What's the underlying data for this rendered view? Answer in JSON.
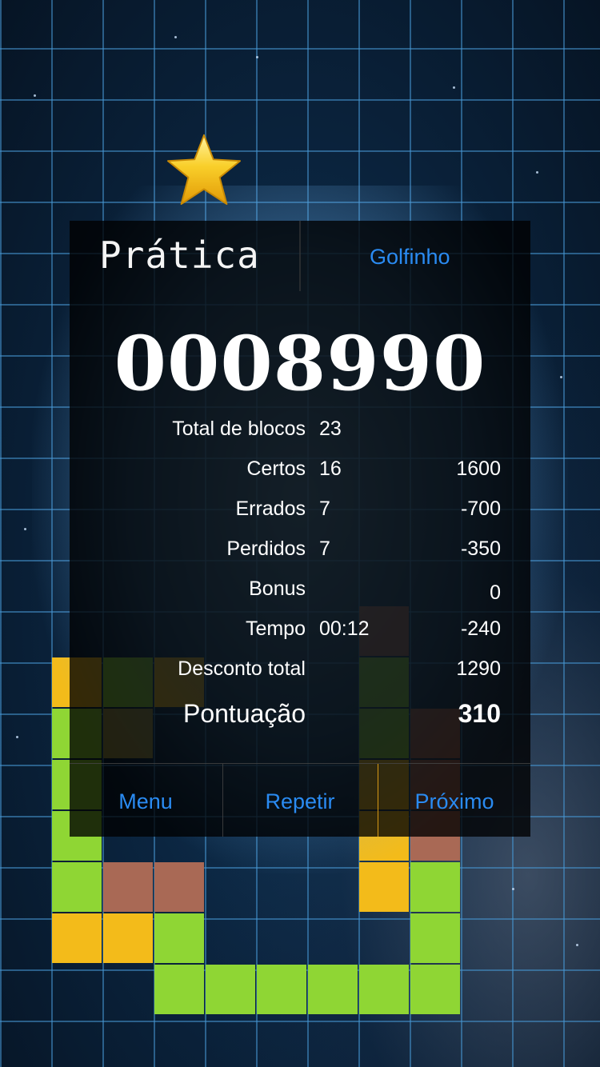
{
  "header": {
    "title": "Prática",
    "mode_label": "Golfinho"
  },
  "score": "0008990",
  "stats": [
    {
      "label": "Total de blocos",
      "count": "23",
      "points": ""
    },
    {
      "label": "Certos",
      "count": "16",
      "points": "1600"
    },
    {
      "label": "Errados",
      "count": "7",
      "points": "-700"
    },
    {
      "label": "Perdidos",
      "count": "7",
      "points": "-350"
    },
    {
      "label": "Bonus",
      "count": "",
      "points": "0"
    },
    {
      "label": "Tempo",
      "count": "00:12",
      "points": "-240"
    },
    {
      "label": "Desconto total",
      "count": "",
      "points": "1290"
    }
  ],
  "final": {
    "label": "Pontuação",
    "points": "310"
  },
  "buttons": {
    "menu": "Menu",
    "retry": "Repetir",
    "next": "Próximo"
  },
  "colors": {
    "accent": "#2a8bf2",
    "block_green": "#8fd634",
    "block_yellow": "#f3bb1a",
    "block_red": "#a96955",
    "star": "#f7c21b"
  },
  "icons": {
    "rating": "star-icon"
  }
}
